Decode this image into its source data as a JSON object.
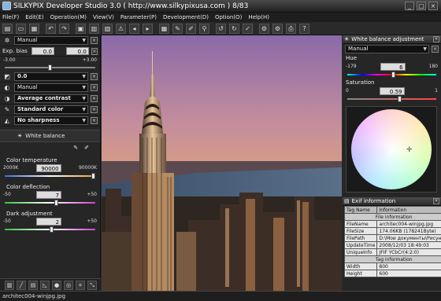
{
  "window": {
    "title": "SILKYPIX Developer Studio 3.0 ( http://www.silkypixusa.com )   8/83"
  },
  "menu": [
    "File(F)",
    "Edit(E)",
    "Operation(M)",
    "View(V)",
    "Parameter(P)",
    "Development(D)",
    "Option(O)",
    "Help(H)"
  ],
  "left": {
    "taste": "Manual",
    "exp_bias_label": "Exp. bias",
    "exp_bias_value": "0.0",
    "exp_bias_value2": "0.0",
    "exp_min": "-3.00",
    "exp_max": "+3.00",
    "exp_level": 0.5,
    "gamma": "0.0",
    "tone": "Manual",
    "contrast": "Average contrast",
    "color": "Standard color",
    "sharpness": "No sharpness",
    "wb_tab": "White balance",
    "color_temp_label": "Color temperature",
    "color_temp_min": "2000K",
    "color_temp_value": "90000",
    "color_temp_max": "90000K",
    "color_temp_level": 0.98,
    "color_defl_label": "Color deflection",
    "color_defl_min": "-50",
    "color_defl_value": "7",
    "color_defl_max": "+50",
    "color_defl_level": 0.57,
    "dark_label": "Dark adjustment",
    "dark_min": "-50",
    "dark_value": "2",
    "dark_max": "+50",
    "dark_level": 0.52
  },
  "wb_panel": {
    "title": "White balance adjustment",
    "mode": "Manual",
    "hue_label": "Hue",
    "hue_min": "-179",
    "hue_value": "6",
    "hue_max": "180",
    "hue_level": 0.52,
    "sat_label": "Saturation",
    "sat_min": "0",
    "sat_value": "0.59",
    "sat_max": "1",
    "sat_level": 0.59
  },
  "exif": {
    "title": "Exif information",
    "headers": [
      "Tag Name",
      "Information"
    ],
    "section_file": "File information",
    "rows": [
      [
        "FileName",
        "architec004-winjpg.jpg"
      ],
      [
        "FileSize",
        "174.06KB (178241Byte)"
      ],
      [
        "FilePath",
        "D:\\Мои документы\\Рисун"
      ],
      [
        "UpdateTime",
        "2008/12/03 18:49:03"
      ],
      [
        "UniqueInfo",
        "JFIF YCbCr(4:2:0)"
      ]
    ],
    "section_tag": "Tag information",
    "rows2": [
      [
        "Width",
        "800"
      ],
      [
        "Height",
        "600"
      ]
    ]
  },
  "status": {
    "filename": "architec004-winjpg.jpg"
  }
}
